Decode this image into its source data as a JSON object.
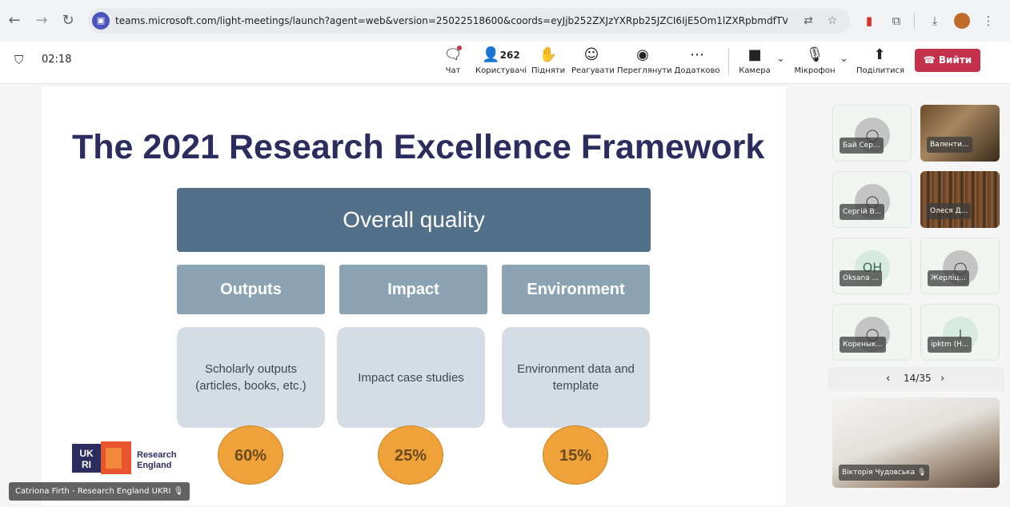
{
  "browser": {
    "url": "teams.microsoft.com/light-meetings/launch?agent=web&version=25022518600&coords=eyJjb252ZXJzYXRpb25JZCI6IjE5Om1lZXRpbmdfTVdWalpE...",
    "back_icon": "arrow-left",
    "forward_icon": "arrow-right",
    "reload_icon": "reload",
    "site_icon": "teams-icon"
  },
  "toolbar": {
    "timer": "02:18",
    "chat": "Чат",
    "people_count": "262",
    "people": "Користувачі",
    "raise": "Підняти",
    "react": "Реагувати",
    "view": "Переглянути",
    "more": "Додатково",
    "camera": "Камера",
    "mic": "Мікрофон",
    "share": "Поділитися",
    "leave": "Вийти"
  },
  "slide": {
    "title": "The 2021 Research Excellence Framework",
    "overall": "Overall quality",
    "columns": [
      {
        "head": "Outputs",
        "body": "Scholarly outputs (articles, books, etc.)",
        "pct": "60%"
      },
      {
        "head": "Impact",
        "body": "Impact case studies",
        "pct": "25%"
      },
      {
        "head": "Environment",
        "body": "Environment data and template",
        "pct": "15%"
      }
    ],
    "logo_text_1": "Research",
    "logo_text_2": "England",
    "logo_mark": "UKRI",
    "speaker": "Catriona Firth - Research England UKRI"
  },
  "participants": {
    "tiles": [
      {
        "name": "Бай Сер..."
      },
      {
        "name": "Валенти..."
      },
      {
        "name": "Сергій В..."
      },
      {
        "name": "Олеся Д..."
      },
      {
        "name": "Oksana ...",
        "initials": "OH"
      },
      {
        "name": "Жерліц..."
      },
      {
        "name": "Коренык..."
      },
      {
        "name": "ipktm (Н...",
        "initials": "I"
      }
    ],
    "pager": "14/35",
    "self_name": "Вікторія Чудовська"
  },
  "colors": {
    "accent": "#4b53bc",
    "leave": "#c4314b",
    "slide_title": "#2b2d5f",
    "overall_box": "#52708a",
    "column_head": "#8ba3b2",
    "column_body": "#d4dce6",
    "percent_circle": "#f0a23a"
  }
}
